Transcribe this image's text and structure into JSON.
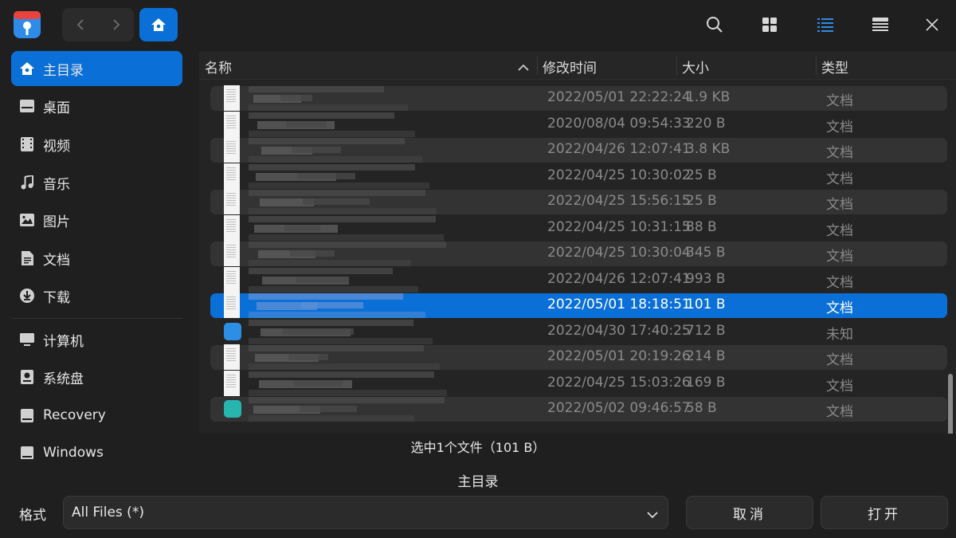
{
  "toolbar": {
    "home_crumb_icon": "home-icon",
    "icons": [
      "search-icon",
      "grid-view-icon",
      "list-view-icon",
      "detail-view-icon",
      "close-icon"
    ]
  },
  "sidebar": {
    "items": [
      {
        "label": "主目录",
        "icon": "home-icon",
        "active": true
      },
      {
        "label": "桌面",
        "icon": "desktop-icon"
      },
      {
        "label": "视频",
        "icon": "video-icon"
      },
      {
        "label": "音乐",
        "icon": "music-icon"
      },
      {
        "label": "图片",
        "icon": "picture-icon"
      },
      {
        "label": "文档",
        "icon": "document-icon"
      },
      {
        "label": "下载",
        "icon": "download-icon"
      },
      {
        "label": "计算机",
        "icon": "computer-icon"
      },
      {
        "label": "系统盘",
        "icon": "system-disk-icon"
      },
      {
        "label": "Recovery",
        "icon": "drive-icon"
      },
      {
        "label": "Windows",
        "icon": "drive-icon"
      }
    ]
  },
  "list": {
    "columns": {
      "name": "名称",
      "modified": "修改时间",
      "size": "大小",
      "type": "类型"
    },
    "rows": [
      {
        "time": "2022/05/01 22:22:24",
        "size": "1.9 KB",
        "type": "文档",
        "thumb": "doc"
      },
      {
        "time": "2020/08/04 09:54:33",
        "size": "220 B",
        "type": "文档",
        "thumb": "doc"
      },
      {
        "time": "2022/04/26 12:07:41",
        "size": "3.8 KB",
        "type": "文档",
        "thumb": "doc"
      },
      {
        "time": "2022/04/25 10:30:02",
        "size": "25 B",
        "type": "文档",
        "thumb": "doc"
      },
      {
        "time": "2022/04/25 15:56:15",
        "size": "25 B",
        "type": "文档",
        "thumb": "doc"
      },
      {
        "time": "2022/04/25 10:31:15",
        "size": "88 B",
        "type": "文档",
        "thumb": "doc"
      },
      {
        "time": "2022/04/25 10:30:04",
        "size": "345 B",
        "type": "文档",
        "thumb": "doc"
      },
      {
        "time": "2022/04/26 12:07:41",
        "size": "993 B",
        "type": "文档",
        "thumb": "doc"
      },
      {
        "time": "2022/05/01 18:18:51",
        "size": "101 B",
        "type": "文档",
        "thumb": "doc",
        "selected": true
      },
      {
        "time": "2022/04/30 17:40:25",
        "size": "712 B",
        "type": "未知",
        "thumb": "app"
      },
      {
        "time": "2022/05/01 20:19:26",
        "size": "214 B",
        "type": "文档",
        "thumb": "doc"
      },
      {
        "time": "2022/04/25 15:03:26",
        "size": "169 B",
        "type": "文档",
        "thumb": "doc"
      },
      {
        "time": "2022/05/02 09:46:57",
        "size": "58 B",
        "type": "文档",
        "thumb": "pkg"
      }
    ]
  },
  "status": {
    "selection": "选中1个文件（101 B）"
  },
  "location": {
    "title": "主目录"
  },
  "footer": {
    "format_label": "格式",
    "format_value": "All Files (*)",
    "cancel_label": "取消",
    "open_label": "打开"
  }
}
